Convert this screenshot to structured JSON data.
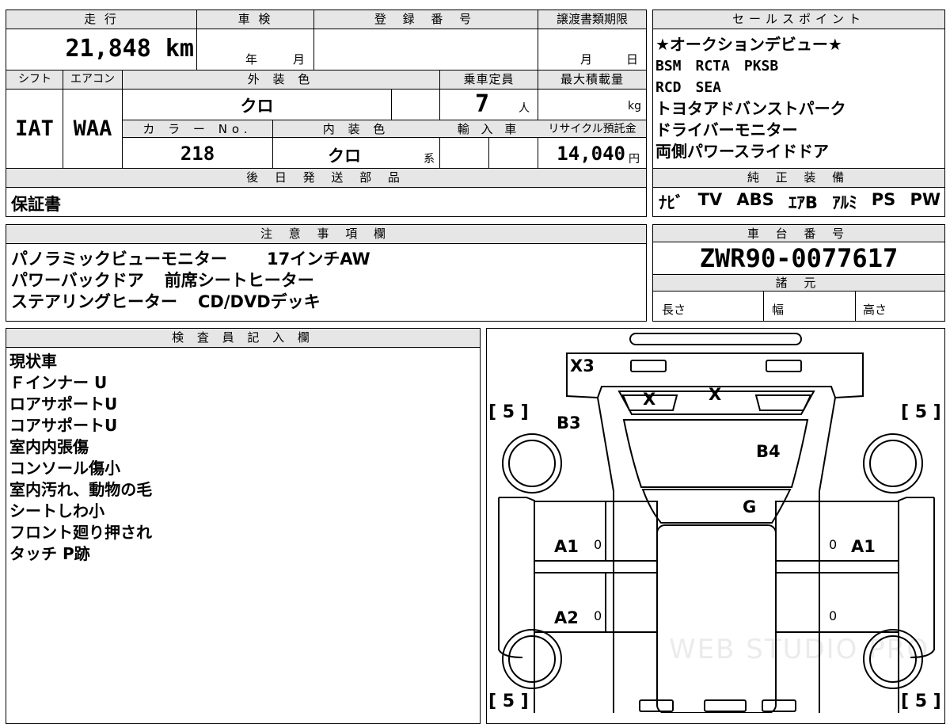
{
  "vehicle": {
    "mileage_label": "走 行",
    "mileage": "21,848",
    "mileage_unit": "km",
    "shaken_label": "車 検",
    "shaken_year": "年",
    "shaken_month": "月",
    "reg_label": "登 録 番 号",
    "transfer_label": "譲渡書類期限",
    "transfer_month": "月",
    "transfer_day": "日",
    "shift_label": "シフト",
    "shift": "IAT",
    "ac_label": "エアコン",
    "ac": "WAA",
    "ext_color_label": "外 装 色",
    "ext_color": "クロ",
    "capacity_label": "乗車定員",
    "capacity": "7",
    "capacity_unit": "人",
    "maxload_label": "最大積載量",
    "maxload_unit": "kg",
    "color_no_label": "カ ラ ー No.",
    "color_no": "218",
    "int_color_label": "内 装 色",
    "int_color": "クロ",
    "int_color_suffix": "系",
    "import_label": "輸 入 車",
    "recycle_label": "リサイクル預託金",
    "recycle": "14,040",
    "recycle_unit": "円",
    "later_parts_label": "後 日 発 送 部 品",
    "later_parts": "保証書"
  },
  "sales_points": {
    "label": "セールスポイント",
    "lines": [
      "★オークションデビュー★",
      "BSM　RCTA　PKSB",
      "RCD　SEA",
      "トヨタアドバンストパーク",
      "ドライバーモニター",
      "両側パワースライドドア"
    ]
  },
  "equipment": {
    "label": "純 正 装 備",
    "items": [
      "ﾅﾋﾞ",
      "TV",
      "ABS",
      "ｴｱB",
      "ｱﾙﾐ",
      "PS",
      "PW"
    ]
  },
  "notes": {
    "label": "注 意 事 項 欄",
    "line1a": "パノラミックビューモニター",
    "line1b": "17インチAW",
    "line2a": "パワーバックドア",
    "line2b": "前席シートヒーター",
    "line3a": "ステアリングヒーター",
    "line3b": "CD/DVDデッキ"
  },
  "chassis": {
    "label": "車 台 番 号",
    "number": "ZWR90-0077617",
    "spec_label": "諸 元",
    "length": "長さ",
    "width": "幅",
    "height": "高さ"
  },
  "inspector": {
    "label": "検 査 員 記 入 欄",
    "lines": [
      "現状車",
      "Ｆインナー U",
      "ロアサポートU",
      "コアサポートU",
      "室内内張傷",
      "コンソール傷小",
      "室内汚れ、動物の毛",
      "シートしわ小",
      "フロント廻り押され",
      "タッチ P跡"
    ]
  },
  "diagram": {
    "marks": {
      "x3": "X3",
      "x1": "X",
      "x2": "X",
      "b3": "B3",
      "b4": "B4",
      "g": "G",
      "a1_left": "A1",
      "a1_right": "A1",
      "a2_left": "A2",
      "zero_a1_left": "0",
      "zero_a1_right": "0",
      "zero_a2_left": "0",
      "zero_a2_right": "0"
    },
    "tire_tl": "[ 5 ]",
    "tire_tr": "[ 5 ]",
    "tire_bl": "[ 5 ]",
    "tire_br": "[ 5 ]",
    "watermark": "WEB STUDIO PRO"
  }
}
